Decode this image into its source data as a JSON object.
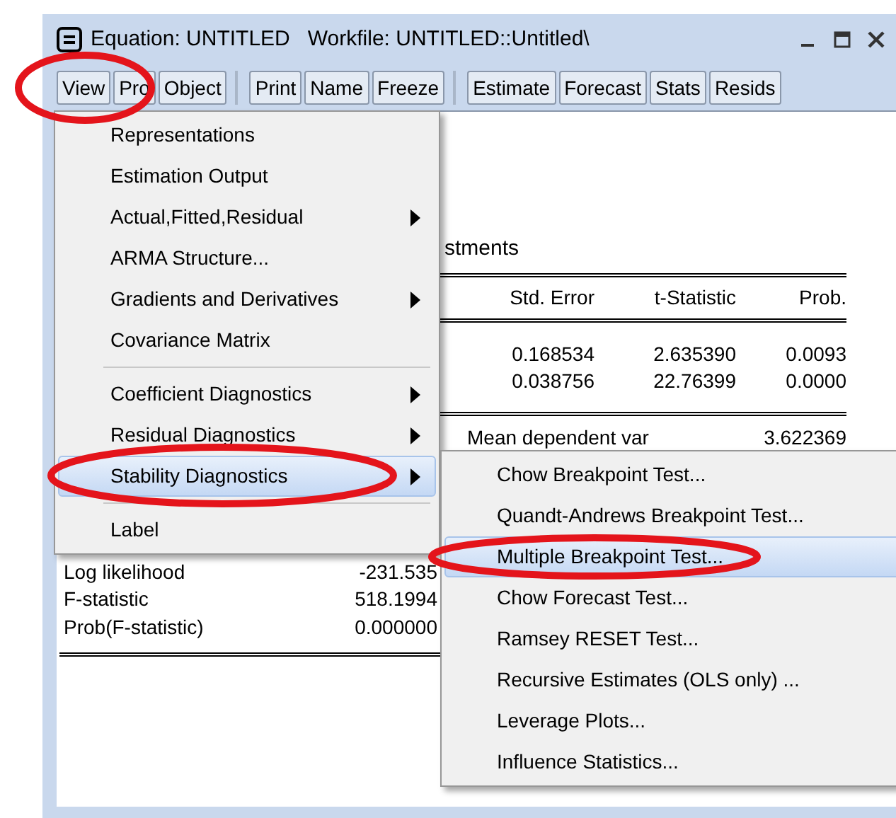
{
  "window": {
    "title": "Equation: UNTITLED   Workfile: UNTITLED::Untitled\\"
  },
  "toolbar": [
    [
      {
        "label": "View",
        "circled": true
      },
      {
        "label": "Pro"
      },
      {
        "label": "Object"
      }
    ],
    [
      {
        "label": "Print"
      },
      {
        "label": "Name"
      },
      {
        "label": "Freeze"
      }
    ],
    [
      {
        "label": "Estimate"
      },
      {
        "label": "Forecast"
      },
      {
        "label": "Stats"
      },
      {
        "label": "Resids"
      }
    ]
  ],
  "output": {
    "heading": "stments",
    "table": {
      "columns": [
        "Std. Error",
        "t-Statistic",
        "Prob."
      ],
      "rows": [
        [
          "0.168534",
          "2.635390",
          "0.0093"
        ],
        [
          "0.038756",
          "22.76399",
          "0.0000"
        ]
      ]
    },
    "stats_right": [
      {
        "label": "Mean dependent var",
        "value": "3.622369"
      }
    ],
    "stats_left": [
      {
        "label": "Log likelihood",
        "value": "-231.535"
      },
      {
        "label": "F-statistic",
        "value": "518.1994"
      },
      {
        "label": "Prob(F-statistic)",
        "value": "0.000000"
      }
    ]
  },
  "menu": {
    "items": [
      {
        "kind": "item",
        "label": "Representations",
        "submenu": false,
        "highlighted": false,
        "circled": false
      },
      {
        "kind": "item",
        "label": "Estimation Output",
        "submenu": false,
        "highlighted": false,
        "circled": false
      },
      {
        "kind": "item",
        "label": "Actual,Fitted,Residual",
        "submenu": true,
        "highlighted": false,
        "circled": false
      },
      {
        "kind": "item",
        "label": "ARMA Structure...",
        "submenu": false,
        "highlighted": false,
        "circled": false
      },
      {
        "kind": "item",
        "label": "Gradients and Derivatives",
        "submenu": true,
        "highlighted": false,
        "circled": false
      },
      {
        "kind": "item",
        "label": "Covariance Matrix",
        "submenu": false,
        "highlighted": false,
        "circled": false
      },
      {
        "kind": "separator"
      },
      {
        "kind": "item",
        "label": "Coefficient Diagnostics",
        "submenu": true,
        "highlighted": false,
        "circled": false
      },
      {
        "kind": "item",
        "label": "Residual Diagnostics",
        "submenu": true,
        "highlighted": false,
        "circled": false
      },
      {
        "kind": "item",
        "label": "Stability Diagnostics",
        "submenu": true,
        "highlighted": true,
        "circled": true
      },
      {
        "kind": "separator"
      },
      {
        "kind": "item",
        "label": "Label",
        "submenu": false,
        "highlighted": false,
        "circled": false
      }
    ]
  },
  "submenu": {
    "items": [
      {
        "kind": "item",
        "label": "Chow Breakpoint Test...",
        "submenu": false,
        "highlighted": false,
        "circled": false
      },
      {
        "kind": "item",
        "label": "Quandt-Andrews Breakpoint Test...",
        "submenu": false,
        "highlighted": false,
        "circled": false
      },
      {
        "kind": "item",
        "label": "Multiple Breakpoint Test...",
        "submenu": false,
        "highlighted": true,
        "circled": true
      },
      {
        "kind": "item",
        "label": "Chow Forecast Test...",
        "submenu": false,
        "highlighted": false,
        "circled": false
      },
      {
        "kind": "item",
        "label": "Ramsey RESET Test...",
        "submenu": false,
        "highlighted": false,
        "circled": false
      },
      {
        "kind": "item",
        "label": "Recursive Estimates (OLS only) ...",
        "submenu": false,
        "highlighted": false,
        "circled": false
      },
      {
        "kind": "item",
        "label": "Leverage Plots...",
        "submenu": false,
        "highlighted": false,
        "circled": false
      },
      {
        "kind": "item",
        "label": "Influence Statistics...",
        "submenu": false,
        "highlighted": false,
        "circled": false
      }
    ]
  }
}
